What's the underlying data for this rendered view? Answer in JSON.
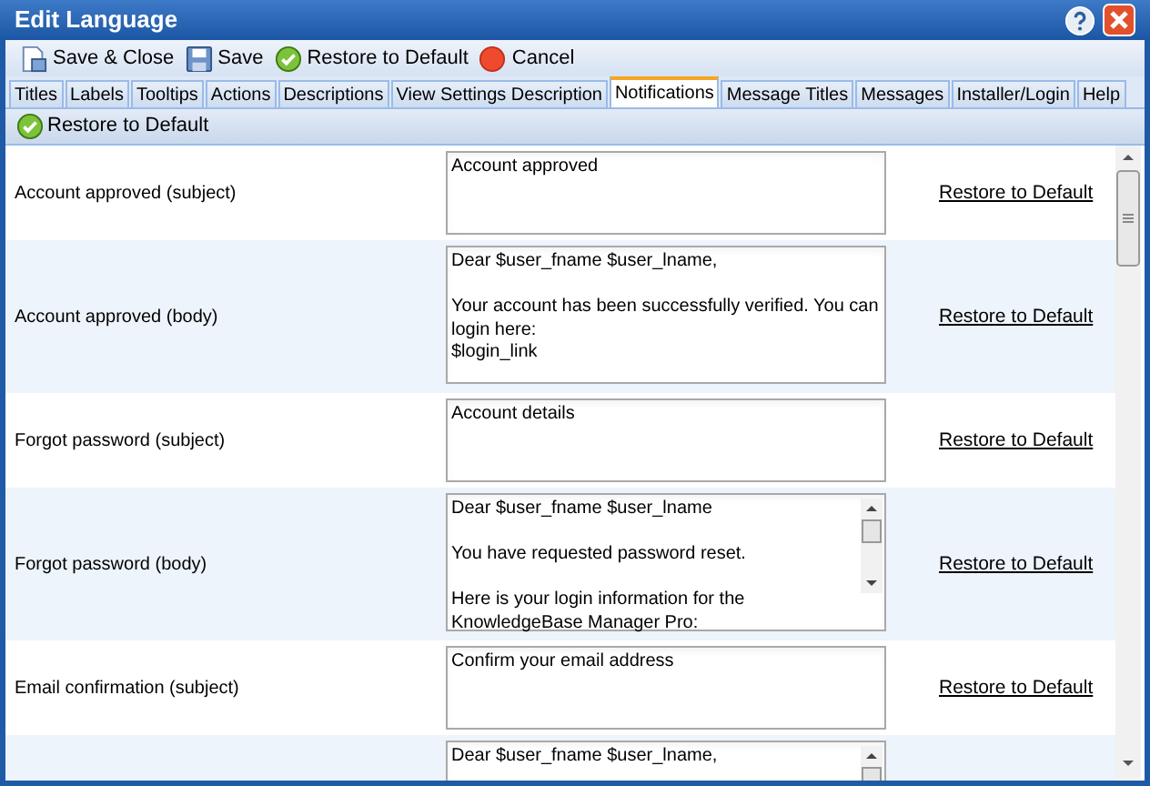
{
  "window": {
    "title": "Edit Language"
  },
  "toolbar": [
    {
      "label": "Save & Close",
      "kind": "save-close"
    },
    {
      "label": "Save",
      "kind": "save"
    },
    {
      "label": "Restore to Default",
      "kind": "restore"
    },
    {
      "label": "Cancel",
      "kind": "cancel"
    }
  ],
  "tabs": [
    {
      "label": "Titles",
      "selected": false
    },
    {
      "label": "Labels",
      "selected": false
    },
    {
      "label": "Tooltips",
      "selected": false
    },
    {
      "label": "Actions",
      "selected": false
    },
    {
      "label": "Descriptions",
      "selected": false
    },
    {
      "label": "View Settings Description",
      "selected": false
    },
    {
      "label": "Notifications",
      "selected": true
    },
    {
      "label": "Message Titles",
      "selected": false
    },
    {
      "label": "Messages",
      "selected": false
    },
    {
      "label": "Installer/Login",
      "selected": false
    },
    {
      "label": "Help",
      "selected": false
    }
  ],
  "sub_toolbar": {
    "button": "Restore to Default"
  },
  "rows": [
    {
      "label": "Account approved (subject)",
      "value": "Account approved",
      "scrollbar": false,
      "link": "Restore to Default"
    },
    {
      "label": "Account approved (body)",
      "value": "Dear $user_fname $user_lname,\n\nYour account has been successfully verified. You can login here:\n$login_link",
      "scrollbar": false,
      "link": "Restore to Default"
    },
    {
      "label": "Forgot password (subject)",
      "value": "Account details",
      "scrollbar": false,
      "link": "Restore to Default"
    },
    {
      "label": "Forgot password (body)",
      "value": "Dear $user_fname $user_lname\n\nYou have requested password reset.\n\nHere is your login information for the\nKnowledgeBase Manager Pro:",
      "scrollbar": true,
      "link": "Restore to Default"
    },
    {
      "label": "Email confirmation (subject)",
      "value": "Confirm your email address",
      "scrollbar": false,
      "link": "Restore to Default"
    },
    {
      "value": "Dear $user_fname $user_lname,",
      "scrollbar": true
    }
  ]
}
